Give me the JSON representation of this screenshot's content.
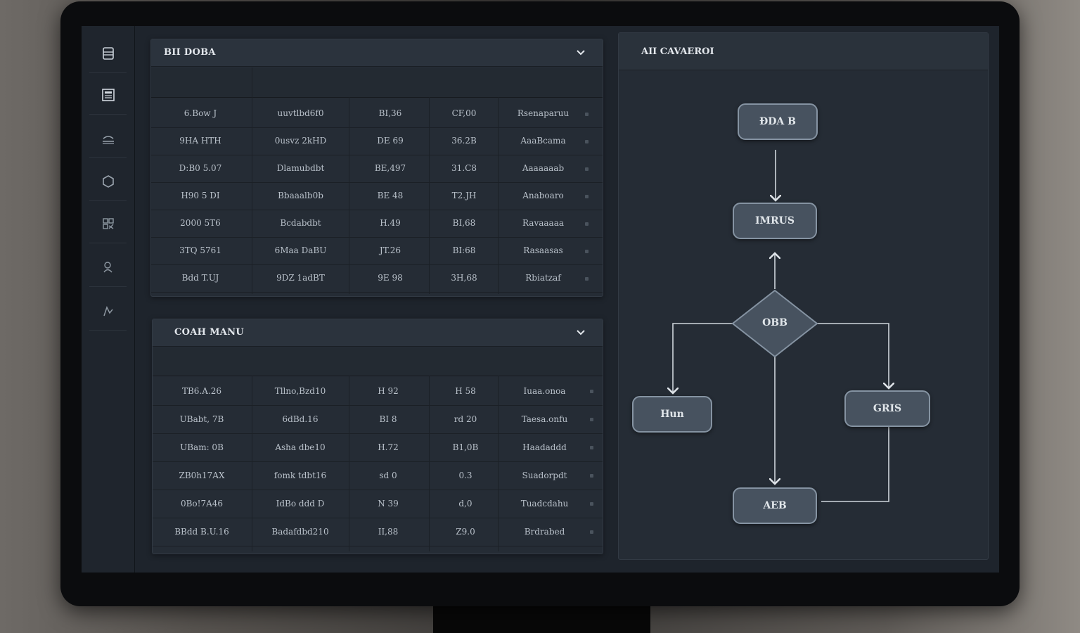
{
  "sidebar": {
    "items": [
      {
        "icon": "database-icon"
      },
      {
        "icon": "document-icon"
      },
      {
        "icon": "layers-icon"
      },
      {
        "icon": "settings-icon"
      },
      {
        "icon": "network-icon"
      },
      {
        "icon": "user-icon"
      },
      {
        "icon": "chart-icon"
      }
    ]
  },
  "panel1": {
    "title": "BII DOBA",
    "columns": [
      "",
      "",
      "",
      "",
      ""
    ],
    "rows": [
      [
        "6.Bow J",
        "uuvtlbd6f0",
        "BI,36",
        "CF,00",
        "Rsenaparuu"
      ],
      [
        "9HA HTH",
        "0usvz 2kHD",
        "DE 69",
        "36.2B",
        "AaaBcama"
      ],
      [
        "D:B0 5.07",
        "Dlamubdbt",
        "BE,497",
        "31.C8",
        "Aaaaaaab"
      ],
      [
        "H90 5 DI",
        "Bbaaalb0b",
        "BE 48",
        "T2.JH",
        "Anaboaro"
      ],
      [
        "2000 5T6",
        "Bcdabdbt",
        "H.49",
        "BI,68",
        "Ravaaaaa"
      ],
      [
        "3TQ 5761",
        "6Maa DaBU",
        "JT.26",
        "BI:68",
        "Rasaasas"
      ],
      [
        "Bdd T.UJ",
        "9DZ 1adBT",
        "9E 98",
        "3H,68",
        "Rbiatzaf"
      ]
    ]
  },
  "panel2": {
    "title": "COAH MANU",
    "columns": [
      "",
      "",
      "",
      "",
      ""
    ],
    "rows": [
      [
        "TB6.A.26",
        "Tllno,Bzd10",
        "H 92",
        "H 58",
        "Iuaa.onoa"
      ],
      [
        "UBabt, 7B",
        "6dBd.16",
        "BI 8",
        "rd 20",
        "Taesa.onfu"
      ],
      [
        "UBam: 0B",
        "Asha dbe10",
        "H.72",
        "B1,0B",
        "Haadaddd"
      ],
      [
        "ZB0h17AX",
        "fomk tdbt16",
        "sd 0",
        "0.3",
        "Suadorpdt"
      ],
      [
        "0Bo!7A46",
        "IdBo ddd D",
        "N 39",
        "d,0",
        "Tuadcdahu"
      ],
      [
        "BBdd B.U.16",
        "Badafdbd210",
        "II,88",
        "Z9.0",
        "Brdrabed"
      ]
    ]
  },
  "flow": {
    "title": "AII CAVAEROI",
    "nodes": {
      "top": "ĐDA B",
      "second": "IMRUS",
      "decision": "OBB",
      "left": "Hun",
      "right": "GRIS",
      "bottom": "AEB"
    }
  }
}
